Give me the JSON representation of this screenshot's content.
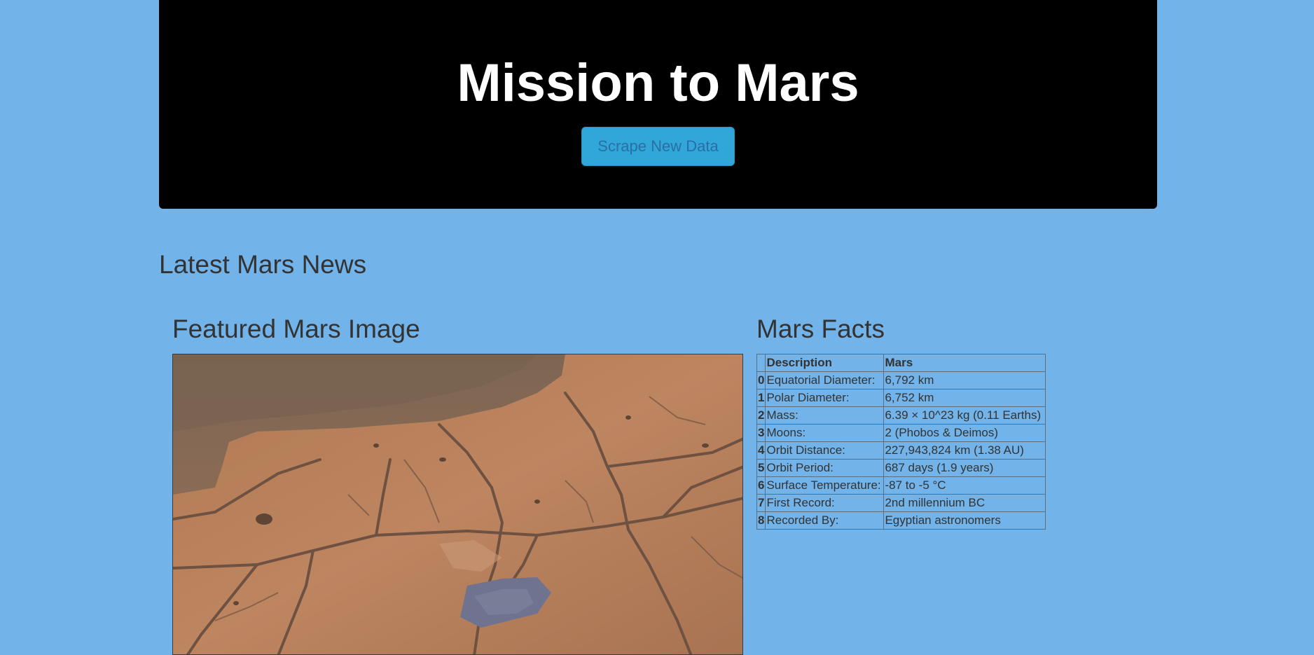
{
  "header": {
    "title": "Mission to Mars",
    "scrape_button_label": "Scrape New Data"
  },
  "news": {
    "heading": "Latest Mars News"
  },
  "featured_image": {
    "heading": "Featured Mars Image"
  },
  "facts": {
    "heading": "Mars Facts",
    "columns": [
      "",
      "Description",
      "Mars"
    ],
    "rows": [
      {
        "index": "0",
        "description": "Equatorial Diameter:",
        "value": "6,792 km"
      },
      {
        "index": "1",
        "description": "Polar Diameter:",
        "value": "6,752 km"
      },
      {
        "index": "2",
        "description": "Mass:",
        "value": "6.39 × 10^23 kg (0.11 Earths)"
      },
      {
        "index": "3",
        "description": "Moons:",
        "value": "2 (Phobos & Deimos)"
      },
      {
        "index": "4",
        "description": "Orbit Distance:",
        "value": "227,943,824 km (1.38 AU)"
      },
      {
        "index": "5",
        "description": "Orbit Period:",
        "value": "687 days (1.9 years)"
      },
      {
        "index": "6",
        "description": "Surface Temperature:",
        "value": "-87 to -5 °C"
      },
      {
        "index": "7",
        "description": "First Record:",
        "value": "2nd millennium BC"
      },
      {
        "index": "8",
        "description": "Recorded By:",
        "value": "Egyptian astronomers"
      }
    ]
  },
  "colors": {
    "page_background": "#72b3e9",
    "jumbotron_background": "#000000",
    "button_background": "#31a7d9",
    "text": "#333333"
  }
}
